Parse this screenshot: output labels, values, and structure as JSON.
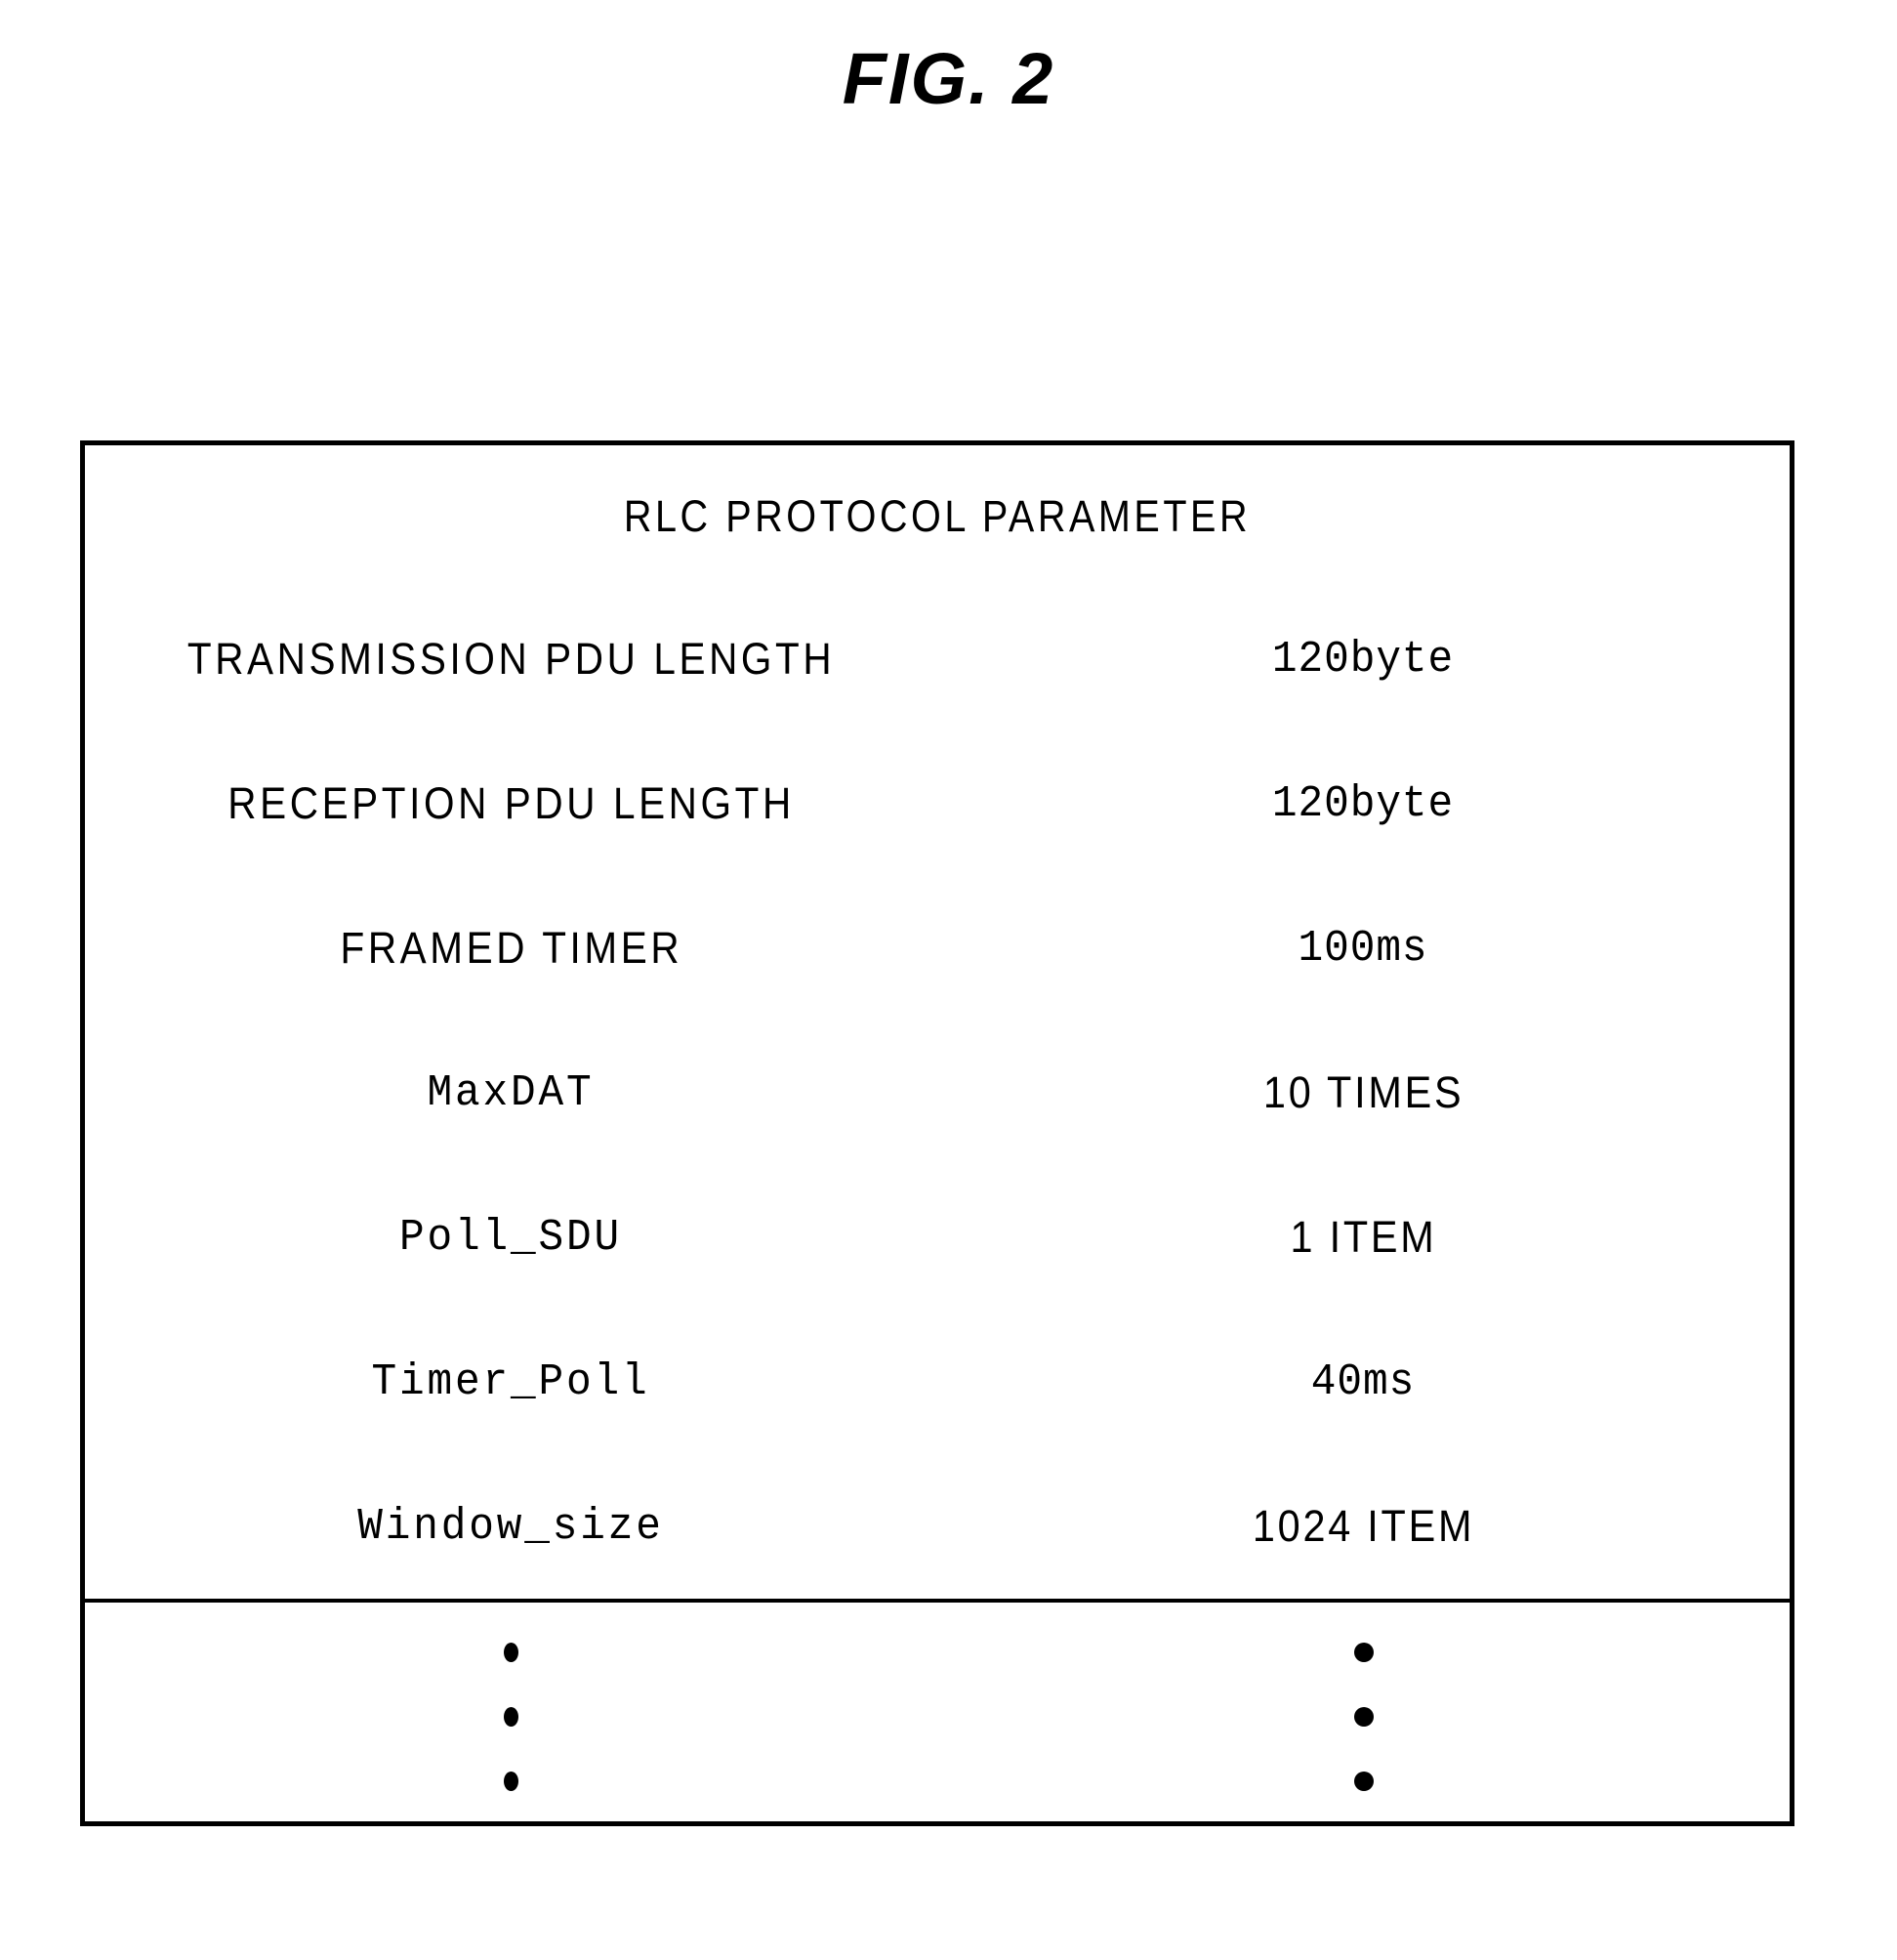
{
  "figure": {
    "title": "FIG. 2"
  },
  "table": {
    "header": "RLC PROTOCOL PARAMETER",
    "rows": [
      {
        "label": "TRANSMISSION PDU LENGTH",
        "value": "120byte"
      },
      {
        "label": "RECEPTION PDU LENGTH",
        "value": "120byte"
      },
      {
        "label": "FRAMED TIMER",
        "value": "100ms"
      },
      {
        "label": "MaxDAT",
        "value": "10 TIMES"
      },
      {
        "label": "Poll_SDU",
        "value": "1 ITEM"
      },
      {
        "label": "Timer_Poll",
        "value": "40ms"
      },
      {
        "label": "Window_size",
        "value": "1024 ITEM"
      }
    ],
    "continuation": {
      "label_marker": "vertical-ellipsis",
      "value_marker": "vertical-ellipsis"
    }
  },
  "colors": {
    "ink": "#000000",
    "paper": "#ffffff"
  }
}
